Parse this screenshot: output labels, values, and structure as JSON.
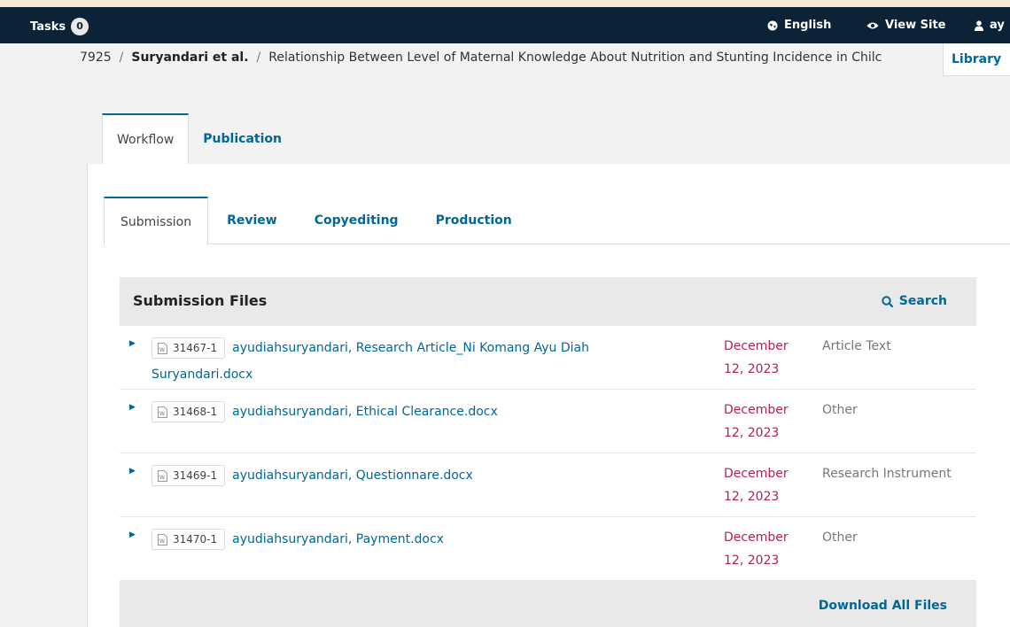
{
  "topbar": {
    "tasks_label": "Tasks",
    "tasks_count": "0",
    "language": "English",
    "view_site": "View Site",
    "user": "ay"
  },
  "library": "Library",
  "breadcrumb": {
    "id": "7925",
    "authors": "Suryandari et al.",
    "title": "Relationship Between Level of Maternal Knowledge About Nutrition and Stunting Incidence in Chilc"
  },
  "main_tabs": [
    "Workflow",
    "Publication"
  ],
  "stage_tabs": [
    "Submission",
    "Review",
    "Copyediting",
    "Production"
  ],
  "submission_files": {
    "title": "Submission Files",
    "search_label": "Search",
    "download_all": "Download All Files",
    "files": [
      {
        "id": "31467-1",
        "name_line1": "ayudiahsuryandari, Research Article_Ni Komang Ayu Diah",
        "name_line2": "Suryandari.docx",
        "date_line1": "December",
        "date_line2": "12, 2023",
        "type": "Article Text"
      },
      {
        "id": "31468-1",
        "name_line1": "ayudiahsuryandari, Ethical Clearance.docx",
        "name_line2": "",
        "date_line1": "December",
        "date_line2": "12, 2023",
        "type": "Other"
      },
      {
        "id": "31469-1",
        "name_line1": "ayudiahsuryandari, Questionnare.docx",
        "name_line2": "",
        "date_line1": "December",
        "date_line2": "12, 2023",
        "type": "Research Instrument"
      },
      {
        "id": "31470-1",
        "name_line1": "ayudiahsuryandari, Payment.docx",
        "name_line2": "",
        "date_line1": "December",
        "date_line2": "12, 2023",
        "type": "Other"
      }
    ]
  },
  "colors": {
    "link": "#006798",
    "date": "#b31f57",
    "topbar": "#0c2236"
  }
}
